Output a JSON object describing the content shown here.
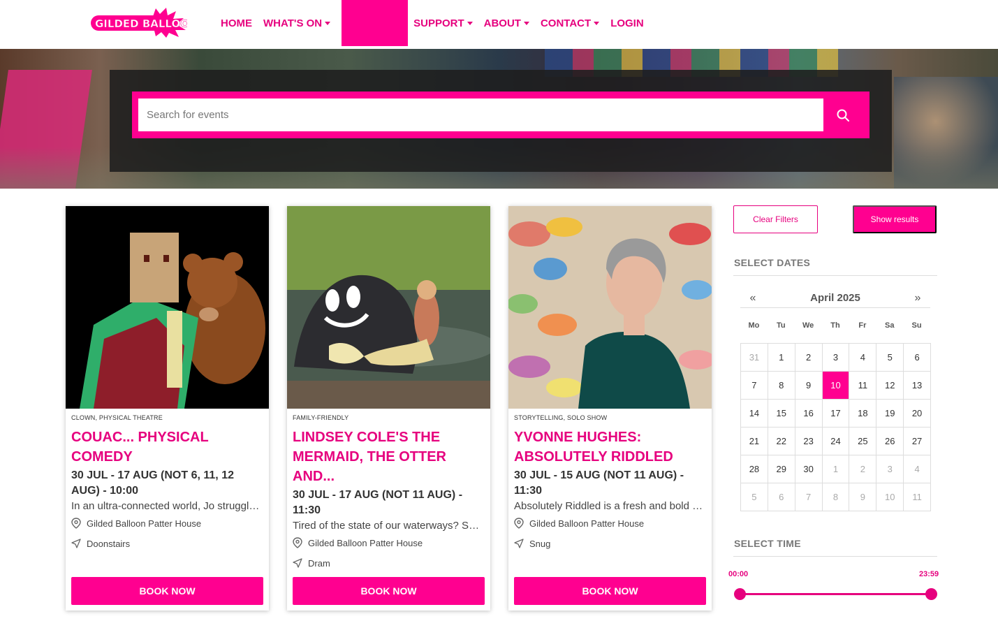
{
  "header": {
    "logo_text": "GILDED BALLOON",
    "nav": [
      {
        "label": "HOME",
        "dropdown": false
      },
      {
        "label": "WHAT'S ON",
        "dropdown": true
      },
      {
        "label": "SUPPORT",
        "dropdown": true
      },
      {
        "label": "ABOUT",
        "dropdown": true
      },
      {
        "label": "CONTACT",
        "dropdown": true
      },
      {
        "label": "LOGIN",
        "dropdown": false
      }
    ]
  },
  "search": {
    "placeholder": "Search for events",
    "icon": "search-icon"
  },
  "cards": [
    {
      "genre": "CLOWN, PHYSICAL THEATRE",
      "title": "COUAC... PHYSICAL COMEDY",
      "dates": "30 JUL - 17 AUG (NOT 6, 11, 12 AUG) - 10:00",
      "description": "In an ultra-connected world, Jo struggles...",
      "venue": "Gilded Balloon Patter House",
      "room": "Doonstairs",
      "book_label": "BOOK NOW"
    },
    {
      "genre": "FAMILY-FRIENDLY",
      "title": "LINDSEY COLE'S THE MERMAID, THE OTTER AND...",
      "dates": "30 JUL - 17 AUG (NOT 11 AUG) - 11:30",
      "description": "Tired of the state of our waterways? So is...",
      "venue": "Gilded Balloon Patter House",
      "room": "Dram",
      "book_label": "BOOK NOW"
    },
    {
      "genre": "STORYTELLING, SOLO SHOW",
      "title": "YVONNE HUGHES: ABSOLUTELY RIDDLED",
      "dates": "30 JUL - 15 AUG (NOT 11 AUG) - 11:30",
      "description": "Absolutely Riddled is a fresh and bold div...",
      "venue": "Gilded Balloon Patter House",
      "room": "Snug",
      "book_label": "BOOK NOW"
    }
  ],
  "filters": {
    "clear_label": "Clear Filters",
    "show_label": "Show results",
    "dates_heading": "SELECT DATES",
    "time_heading": "SELECT TIME",
    "calendar": {
      "prev": "«",
      "next": "»",
      "month": "April 2025",
      "weekdays": [
        "Mo",
        "Tu",
        "We",
        "Th",
        "Fr",
        "Sa",
        "Su"
      ],
      "selected_day": "10",
      "days": [
        {
          "d": "31",
          "muted": true
        },
        {
          "d": "1"
        },
        {
          "d": "2"
        },
        {
          "d": "3"
        },
        {
          "d": "4"
        },
        {
          "d": "5"
        },
        {
          "d": "6"
        },
        {
          "d": "7"
        },
        {
          "d": "8"
        },
        {
          "d": "9"
        },
        {
          "d": "10",
          "selected": true
        },
        {
          "d": "11"
        },
        {
          "d": "12"
        },
        {
          "d": "13"
        },
        {
          "d": "14"
        },
        {
          "d": "15"
        },
        {
          "d": "16"
        },
        {
          "d": "17"
        },
        {
          "d": "18"
        },
        {
          "d": "19"
        },
        {
          "d": "20"
        },
        {
          "d": "21"
        },
        {
          "d": "22"
        },
        {
          "d": "23"
        },
        {
          "d": "24"
        },
        {
          "d": "25"
        },
        {
          "d": "26"
        },
        {
          "d": "27"
        },
        {
          "d": "28"
        },
        {
          "d": "29"
        },
        {
          "d": "30"
        },
        {
          "d": "1",
          "muted": true
        },
        {
          "d": "2",
          "muted": true
        },
        {
          "d": "3",
          "muted": true
        },
        {
          "d": "4",
          "muted": true
        },
        {
          "d": "5",
          "muted": true
        },
        {
          "d": "6",
          "muted": true
        },
        {
          "d": "7",
          "muted": true
        },
        {
          "d": "8",
          "muted": true
        },
        {
          "d": "9",
          "muted": true
        },
        {
          "d": "10",
          "muted": true
        },
        {
          "d": "11",
          "muted": true
        }
      ]
    },
    "time": {
      "start": "00:00",
      "end": "23:59",
      "range_start_fraction": 0,
      "range_end_fraction": 1
    }
  },
  "colors": {
    "brand": "#e6007e",
    "brand_bright": "#ff0090"
  }
}
